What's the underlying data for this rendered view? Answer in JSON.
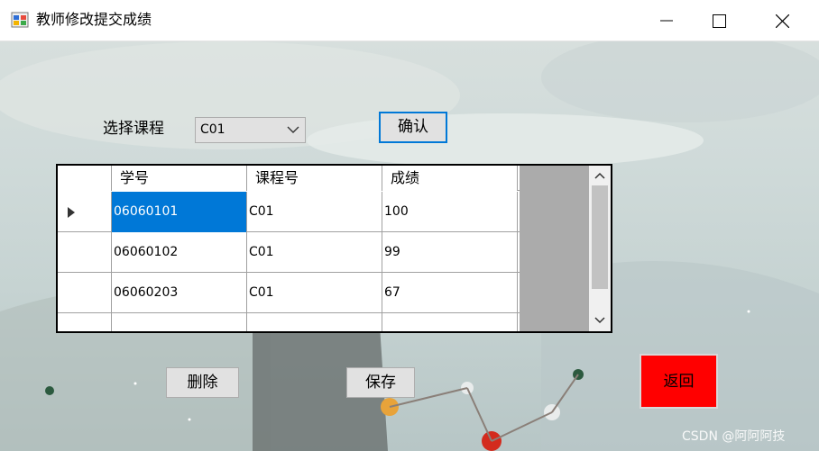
{
  "window": {
    "title": "教师修改提交成绩"
  },
  "form": {
    "course_label": "选择课程",
    "course_selected": "C01",
    "confirm_label": "确认",
    "delete_label": "删除",
    "save_label": "保存",
    "back_label": "返回"
  },
  "grid": {
    "columns": [
      "学号",
      "课程号",
      "成绩"
    ],
    "rows": [
      [
        "06060101",
        "C01",
        "100"
      ],
      [
        "06060102",
        "C01",
        "99"
      ],
      [
        "06060203",
        "C01",
        "67"
      ]
    ]
  },
  "watermark": "CSDN @阿阿阿技",
  "colors": {
    "selection": "#0078d7",
    "back_button": "#ff0000",
    "grid_background": "#ababab"
  }
}
